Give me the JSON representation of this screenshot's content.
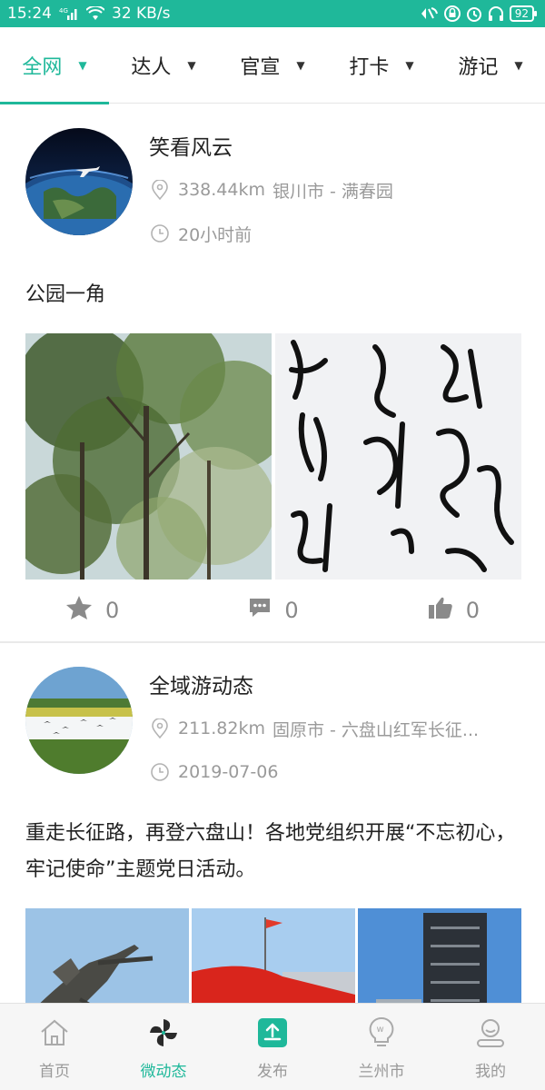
{
  "status_bar": {
    "time": "15:24",
    "network_type": "4G",
    "speed": "32 KB/s",
    "battery": "92",
    "icons": [
      "signal-icon",
      "wifi-icon",
      "nfc-icon",
      "lock-icon",
      "alarm-icon",
      "headset-icon",
      "battery-icon"
    ]
  },
  "tabs": [
    {
      "label": "全网",
      "active": true
    },
    {
      "label": "达人",
      "active": false
    },
    {
      "label": "官宣",
      "active": false
    },
    {
      "label": "打卡",
      "active": false
    },
    {
      "label": "游记",
      "active": false
    }
  ],
  "posts": [
    {
      "author": "笑看风云",
      "distance": "338.44km",
      "location": "银川市 - 满春园",
      "time": "20小时前",
      "text": "公园一角",
      "image_count": 2,
      "likes_star": "0",
      "comments": "0",
      "thumbs": "0"
    },
    {
      "author": "全域游动态",
      "distance": "211.82km",
      "location": "固原市 - 六盘山红军长征...",
      "time": "2019-07-06",
      "text": "重走长征路，再登六盘山！各地党组织开展“不忘初心，牢记使命”主题党日活动。",
      "image_count": 3
    }
  ],
  "bottom_nav": [
    {
      "label": "首页",
      "icon": "home-icon",
      "active": false
    },
    {
      "label": "微动态",
      "icon": "pinwheel-icon",
      "active": true
    },
    {
      "label": "发布",
      "icon": "upload-icon",
      "active": false
    },
    {
      "label": "兰州市",
      "icon": "bulb-icon",
      "active": false
    },
    {
      "label": "我的",
      "icon": "user-icon",
      "active": false
    }
  ],
  "colors": {
    "accent": "#1fb89a",
    "muted": "#9a9a9a"
  }
}
